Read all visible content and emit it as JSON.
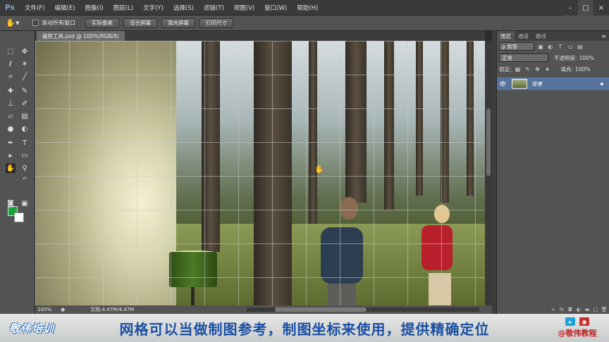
{
  "app": {
    "logo": "Ps"
  },
  "menubar": {
    "items": [
      "文件(F)",
      "编辑(E)",
      "图像(I)",
      "图层(L)",
      "文字(Y)",
      "选择(S)",
      "滤镜(T)",
      "视图(V)",
      "窗口(W)",
      "帮助(H)"
    ]
  },
  "window_controls": [
    "–",
    "□",
    "×"
  ],
  "options": {
    "scroll_all_windows": "滚动所有窗口",
    "buttons": [
      "实际像素",
      "适合屏幕",
      "填充屏幕",
      "打印尺寸"
    ]
  },
  "document": {
    "tab_title": "裁剪工具.psd @ 100%(RGB/8)",
    "zoom": "100%",
    "doc_info": "文档:4.47M/4.47M"
  },
  "colors": {
    "foreground": "#17a33a",
    "background": "#ffffff",
    "selection": "#56749b"
  },
  "layers_panel": {
    "tabs": [
      "图层",
      "通道",
      "路径"
    ],
    "kind_label": "ρ 类型",
    "blend_mode": "正常",
    "opacity_label": "不透明度:",
    "opacity_value": "100%",
    "lock_label": "锁定:",
    "fill_label": "填充:",
    "fill_value": "100%",
    "layers": [
      {
        "name": "背景",
        "visible": true,
        "locked": true
      }
    ]
  },
  "caption": {
    "brand_left": "敬伟培训",
    "text": "网格可以当做制图参考，制图坐标来使用，提供精确定位",
    "brand_right": "@敬伟教程"
  }
}
